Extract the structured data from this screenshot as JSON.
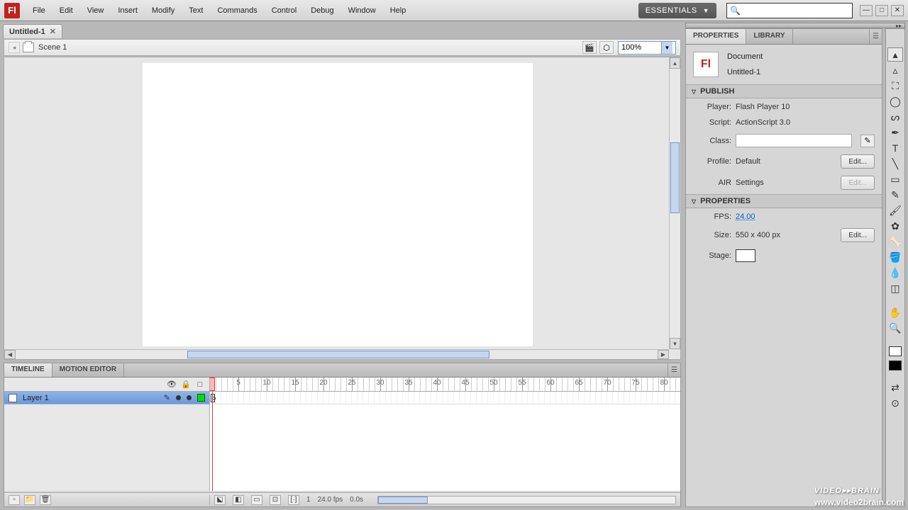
{
  "menu": [
    "File",
    "Edit",
    "View",
    "Insert",
    "Modify",
    "Text",
    "Commands",
    "Control",
    "Debug",
    "Window",
    "Help"
  ],
  "workspace": "ESSENTIALS",
  "doc_tab": "Untitled-1",
  "scene": {
    "label": "Scene 1",
    "zoom": "100%"
  },
  "timeline": {
    "tabs": {
      "timeline": "TIMELINE",
      "motion": "MOTION EDITOR"
    },
    "layer": "Layer 1",
    "ruler_ticks": [
      5,
      10,
      15,
      20,
      25,
      30,
      35,
      40,
      45,
      50,
      55,
      60,
      65,
      70,
      75,
      80
    ],
    "status": {
      "frame": "1",
      "fps": "24.0 fps",
      "time": "0.0s"
    }
  },
  "props": {
    "tabs": {
      "properties": "PROPERTIES",
      "library": "LIBRARY"
    },
    "doc_type": "Document",
    "doc_name": "Untitled-1",
    "sections": {
      "publish": "PUBLISH",
      "properties": "PROPERTIES"
    },
    "publish": {
      "player_label": "Player:",
      "player_val": "Flash Player 10",
      "script_label": "Script:",
      "script_val": "ActionScript 3.0",
      "class_label": "Class:",
      "profile_label": "Profile:",
      "profile_val": "Default",
      "air_label": "AIR",
      "air_val": "Settings"
    },
    "properties": {
      "fps_label": "FPS:",
      "fps_val": "24.00",
      "size_label": "Size:",
      "size_val": "550 x 400 px",
      "stage_label": "Stage:"
    },
    "edit_btn": "Edit..."
  },
  "watermark": {
    "brand": "VIDEO▸▸BRAIN",
    "url": "www.video2brain.com"
  }
}
